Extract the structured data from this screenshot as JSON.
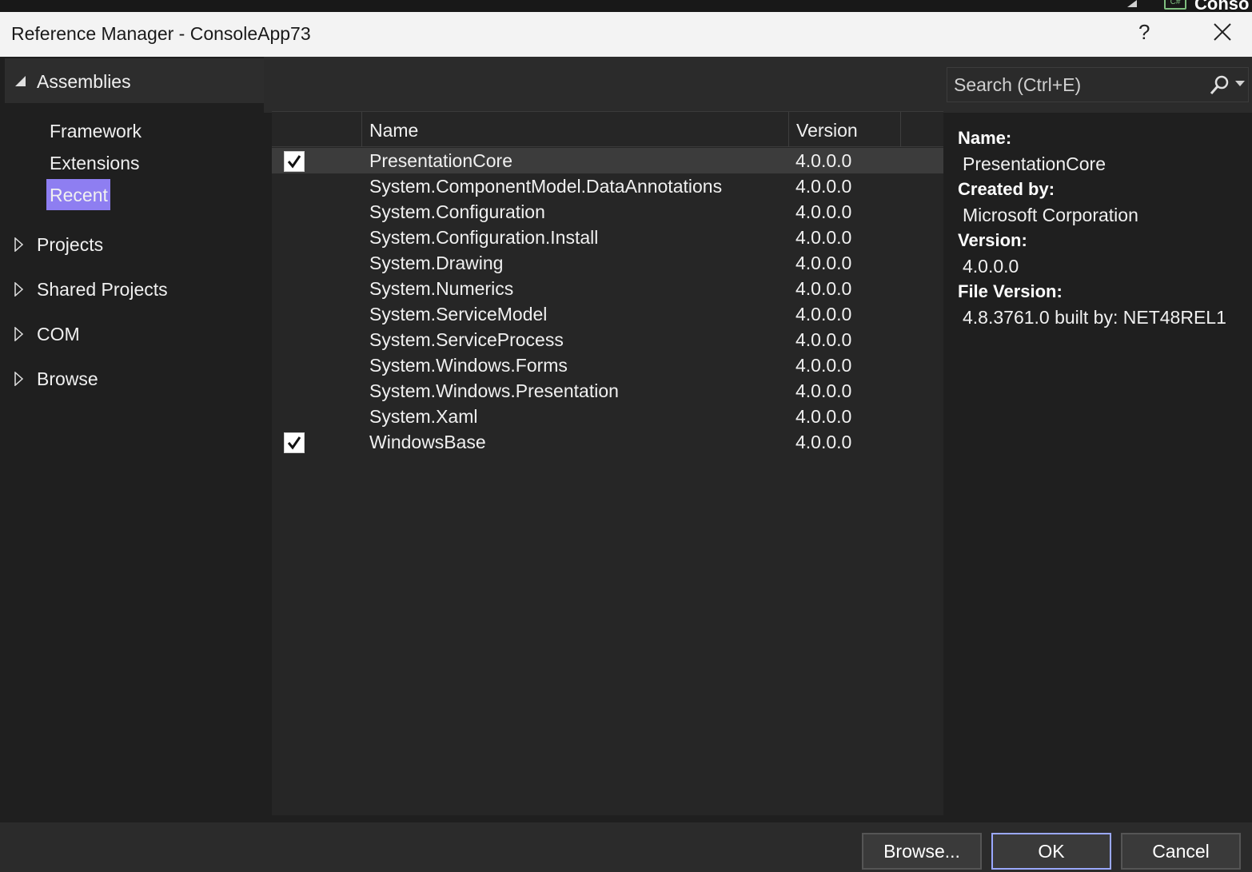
{
  "ide_background": {
    "lang_badge": "C#",
    "title_fragment": "Conso"
  },
  "dialog": {
    "title": "Reference Manager - ConsoleApp73",
    "help_label": "?"
  },
  "nav": {
    "assemblies_label": "Assemblies",
    "sub_items": [
      "Framework",
      "Extensions",
      "Recent"
    ],
    "selected_sub_item": "Recent",
    "groups": [
      "Projects",
      "Shared Projects",
      "COM",
      "Browse"
    ]
  },
  "search": {
    "placeholder": "Search (Ctrl+E)"
  },
  "grid": {
    "columns": [
      "Name",
      "Version"
    ],
    "rows": [
      {
        "name": "PresentationCore",
        "version": "4.0.0.0",
        "checked": true,
        "selected": true
      },
      {
        "name": "System.ComponentModel.DataAnnotations",
        "version": "4.0.0.0",
        "checked": false,
        "selected": false
      },
      {
        "name": "System.Configuration",
        "version": "4.0.0.0",
        "checked": false,
        "selected": false
      },
      {
        "name": "System.Configuration.Install",
        "version": "4.0.0.0",
        "checked": false,
        "selected": false
      },
      {
        "name": "System.Drawing",
        "version": "4.0.0.0",
        "checked": false,
        "selected": false
      },
      {
        "name": "System.Numerics",
        "version": "4.0.0.0",
        "checked": false,
        "selected": false
      },
      {
        "name": "System.ServiceModel",
        "version": "4.0.0.0",
        "checked": false,
        "selected": false
      },
      {
        "name": "System.ServiceProcess",
        "version": "4.0.0.0",
        "checked": false,
        "selected": false
      },
      {
        "name": "System.Windows.Forms",
        "version": "4.0.0.0",
        "checked": false,
        "selected": false
      },
      {
        "name": "System.Windows.Presentation",
        "version": "4.0.0.0",
        "checked": false,
        "selected": false
      },
      {
        "name": "System.Xaml",
        "version": "4.0.0.0",
        "checked": false,
        "selected": false
      },
      {
        "name": "WindowsBase",
        "version": "4.0.0.0",
        "checked": true,
        "selected": false
      }
    ]
  },
  "details": {
    "name_label": "Name:",
    "name_value": "PresentationCore",
    "created_label": "Created by:",
    "created_value": "Microsoft Corporation",
    "version_label": "Version:",
    "version_value": "4.0.0.0",
    "file_version_label": "File Version:",
    "file_version_value": "4.8.3761.0 built by: NET48REL1"
  },
  "buttons": {
    "browse": "Browse...",
    "ok": "OK",
    "cancel": "Cancel"
  },
  "colors": {
    "selection_accent": "#8e7ef1",
    "ok_border": "#9aa8ff"
  }
}
